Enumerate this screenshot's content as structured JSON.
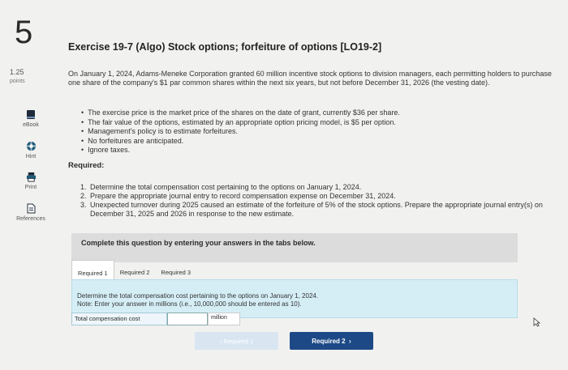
{
  "question_number": "5",
  "points": {
    "value": "1.25",
    "label": "points"
  },
  "tools": [
    {
      "label": "eBook",
      "icon": "book-icon"
    },
    {
      "label": "Hint",
      "icon": "lifebuoy-icon"
    },
    {
      "label": "Print",
      "icon": "printer-icon"
    },
    {
      "label": "References",
      "icon": "document-icon"
    }
  ],
  "title": "Exercise 19-7 (Algo) Stock options; forfeiture of options [LO19-2]",
  "intro": "On January 1, 2024, Adams-Meneke Corporation granted 60 million incentive stock options to division managers, each permitting holders to purchase one share of the company's $1 par common shares within the next six years, but not before December 31, 2026 (the vesting date).",
  "bullets": [
    "The exercise price is the market price of the shares on the date of grant, currently $36 per share.",
    "The fair value of the options, estimated by an appropriate option pricing model, is $5 per option.",
    "Management's policy is to estimate forfeitures.",
    "No forfeitures are anticipated.",
    "Ignore taxes."
  ],
  "required_heading": "Required:",
  "requirements": [
    {
      "num": "1.",
      "text": "Determine the total compensation cost pertaining to the options on January 1, 2024."
    },
    {
      "num": "2.",
      "text": "Prepare the appropriate journal entry to record compensation expense on December 31, 2024."
    },
    {
      "num": "3.",
      "text": "Unexpected turnover during 2025 caused an estimate of the forfeiture of 5% of the stock options. Prepare the appropriate journal entry(s) on December 31, 2025 and 2026 in response to the new estimate."
    }
  ],
  "complete_notice": "Complete this question by entering your answers in the tabs below.",
  "tabs": [
    "Required 1",
    "Required 2",
    "Required 3"
  ],
  "active_tab": "Required 1",
  "instruction": "Determine the total compensation cost pertaining to the options on January 1, 2024.",
  "note": "Note: Enter your answer in millions (i.e., 10,000,000 should be entered as 10).",
  "field": {
    "label": "Total compensation cost",
    "value": "",
    "unit": "million"
  },
  "nav": {
    "prev": "Required 1",
    "next": "Required 2"
  }
}
